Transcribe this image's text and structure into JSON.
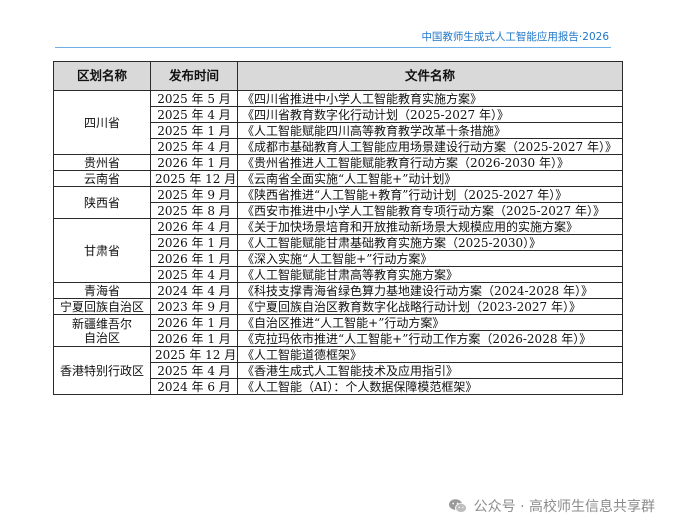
{
  "header": {
    "title": "中国教师生成式人工智能应用报告·2026"
  },
  "table": {
    "columns": [
      "区划名称",
      "发布时间",
      "文件名称"
    ],
    "rows": [
      {
        "region": "四川省",
        "date": "2025 年 5 月",
        "doc": "《四川省推进中小学人工智能教育实施方案》"
      },
      {
        "region": "四川省",
        "date": "2025 年 4 月",
        "doc": "《四川省教育数字化行动计划（2025-2027 年）》"
      },
      {
        "region": "四川省",
        "date": "2025 年 1 月",
        "doc": "《人工智能赋能四川高等教育教学改革十条措施》"
      },
      {
        "region": "四川省",
        "date": "2025 年 4 月",
        "doc": "《成都市基础教育人工智能应用场景建设行动方案（2025-2027 年）》"
      },
      {
        "region": "贵州省",
        "date": "2026 年 1 月",
        "doc": "《贵州省推进人工智能赋能教育行动方案（2026-2030 年）》"
      },
      {
        "region": "云南省",
        "date": "2025 年 12 月",
        "doc": "《云南省全面实施“人工智能+”动计划》"
      },
      {
        "region": "陕西省",
        "date": "2025 年 9 月",
        "doc": "《陕西省推进“人工智能+教育”行动计划（2025-2027 年）》"
      },
      {
        "region": "陕西省",
        "date": "2025 年 8 月",
        "doc": "《西安市推进中小学人工智能教育专项行动方案（2025-2027 年）》"
      },
      {
        "region": "甘肃省",
        "date": "2026 年 4 月",
        "doc": "《关于加快场景培育和开放推动新场景大规模应用的实施方案》"
      },
      {
        "region": "甘肃省",
        "date": "2026 年 1 月",
        "doc": "《人工智能赋能甘肃基础教育实施方案（2025-2030）》"
      },
      {
        "region": "甘肃省",
        "date": "2026 年 1 月",
        "doc": "《深入实施“人工智能+”行动方案》"
      },
      {
        "region": "甘肃省",
        "date": "2025 年 4 月",
        "doc": "《人工智能赋能甘肃高等教育实施方案》"
      },
      {
        "region": "青海省",
        "date": "2024 年 4 月",
        "doc": "《科技支撑青海省绿色算力基地建设行动方案（2024-2028 年）》"
      },
      {
        "region": "宁夏回族自治区",
        "date": "2023 年 9 月",
        "doc": "《宁夏回族自治区教育数字化战略行动计划（2023-2027 年）》"
      },
      {
        "region": "新疆维吾尔自治区",
        "date": "2026 年 1 月",
        "doc": "《自治区推进“人工智能+”行动方案》"
      },
      {
        "region": "新疆维吾尔自治区",
        "date": "2026 年 1 月",
        "doc": "《克拉玛依市推进“人工智能+”行动工作方案（2026-2028 年）》"
      },
      {
        "region": "香港特别行政区",
        "date": "2025 年 12 月",
        "doc": "《人工智能道德框架》"
      },
      {
        "region": "香港特别行政区",
        "date": "2025 年 4 月",
        "doc": "《香港生成式人工智能技术及应用指引》"
      },
      {
        "region": "香港特别行政区",
        "date": "2024 年 6 月",
        "doc": "《人工智能（AI）：个人数据保障模范框架》"
      }
    ],
    "region_display": {
      "新疆维吾尔自治区": "新疆维吾尔\n自治区"
    }
  },
  "watermark": {
    "text": "公众号 · 高校师生信息共享群",
    "icon": "wechat-icon"
  }
}
